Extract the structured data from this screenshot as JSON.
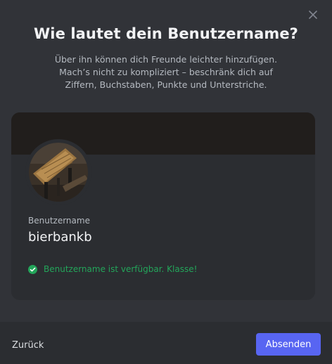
{
  "modal": {
    "title": "Wie lautet dein Benutzername?",
    "subtitle_lines": [
      "Über ihn können dich Freunde leichter hinzufügen.",
      "Mach’s nicht zu kompliziert – beschränk dich auf",
      "Ziffern, Buchstaben, Punkte und Unterstriche."
    ],
    "close_icon": "close-icon"
  },
  "profile_card": {
    "avatar_icon": "profile-avatar",
    "field_label": "Benutzername",
    "username": "bierbankb",
    "status_icon": "check-circle-icon",
    "status_text": "Benutzername ist verfügbar. Klasse!"
  },
  "footer": {
    "back_label": "Zurück",
    "submit_label": "Absenden"
  },
  "colors": {
    "background": "#313338",
    "card": "#2b2d31",
    "banner": "#211e1c",
    "accent": "#5865f2",
    "success": "#23a55a",
    "title_text": "#f2f3f5",
    "muted_text": "#b5bac1"
  }
}
